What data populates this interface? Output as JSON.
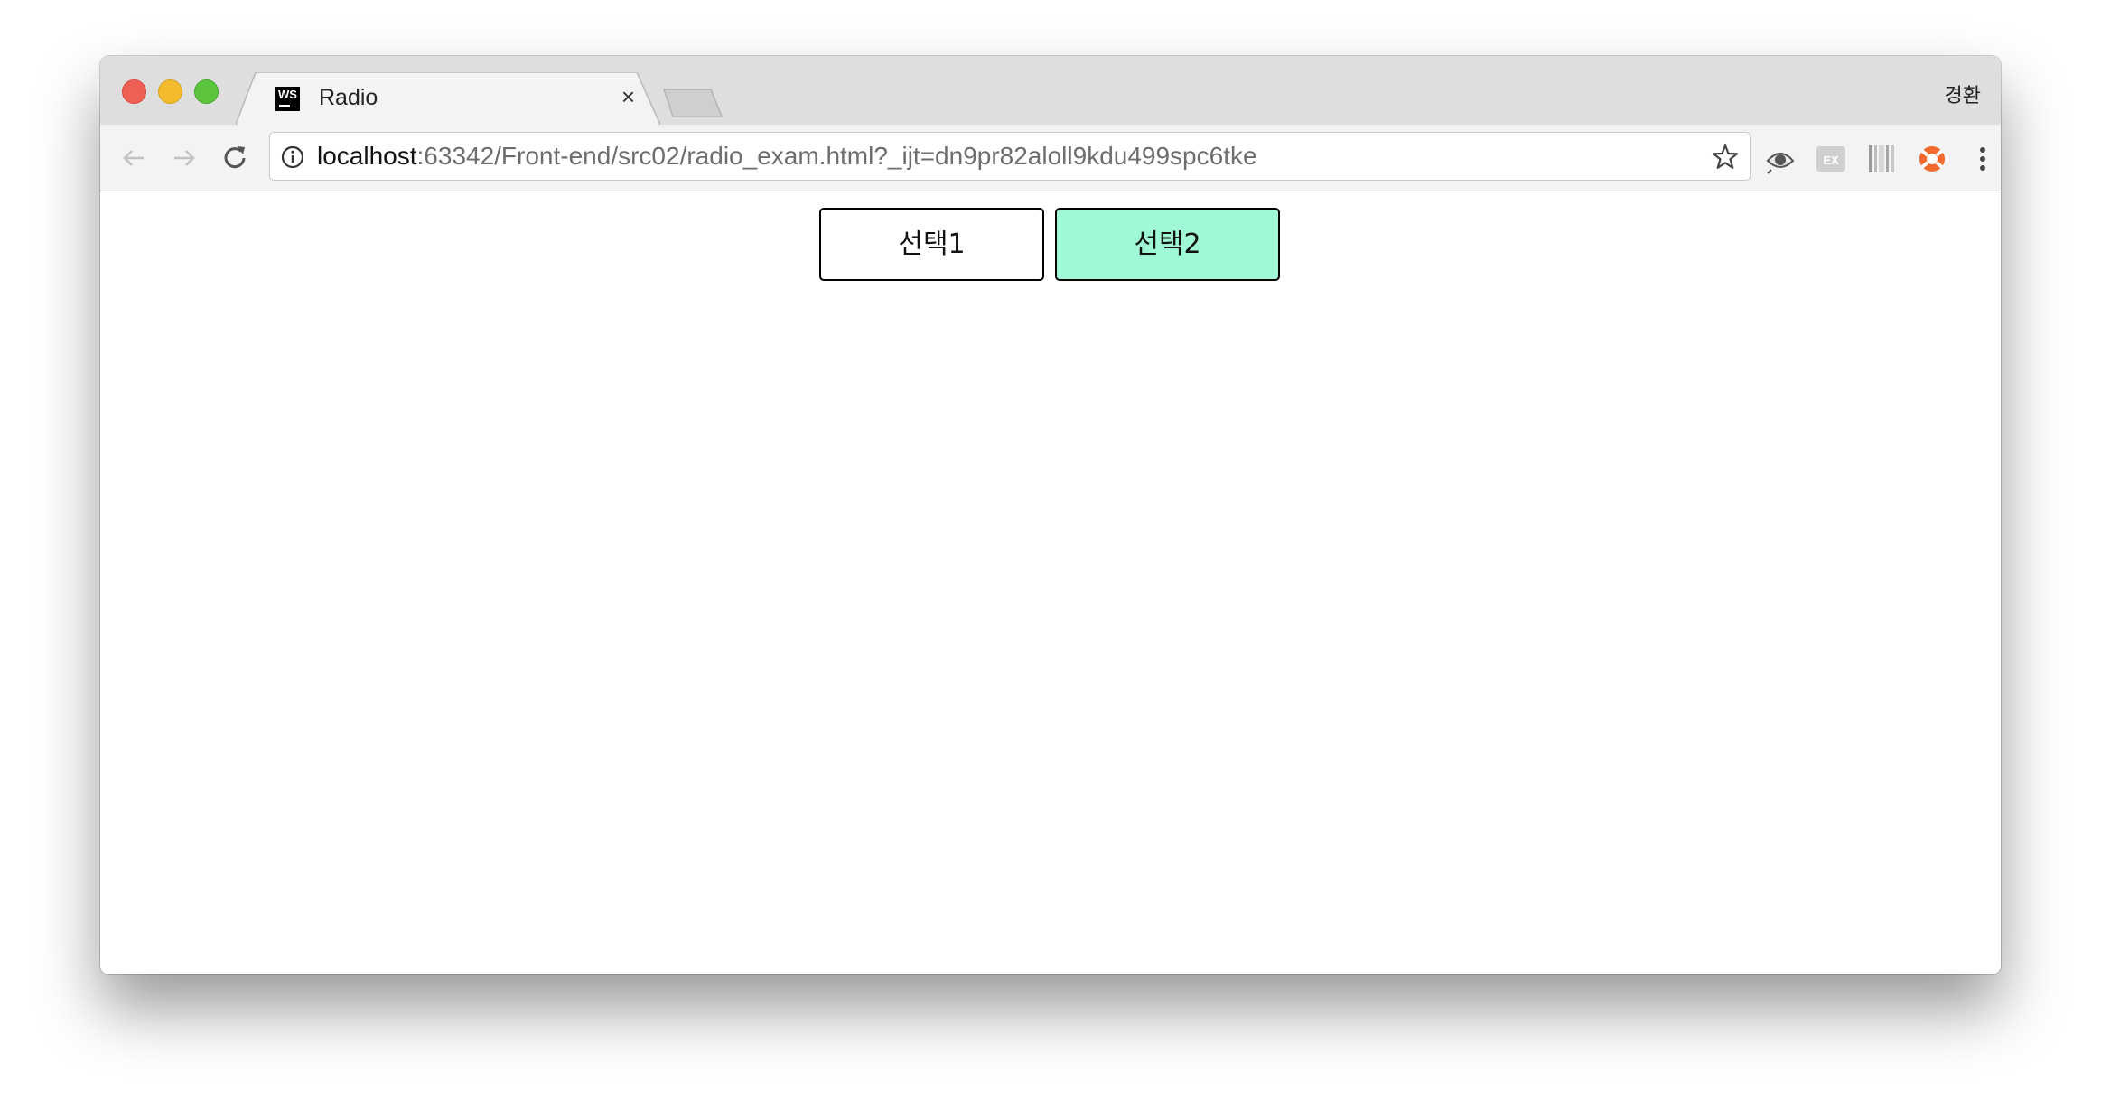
{
  "window": {
    "tab_title": "Radio",
    "favicon_text": "WS",
    "tab_close": "×",
    "profile_name": "경환"
  },
  "toolbar": {
    "url_host": "localhost",
    "url_rest": ":63342/Front-end/src02/radio_exam.html?_ijt=dn9pr82aloll9kdu499spc6tke"
  },
  "content": {
    "options": [
      {
        "label": "선택1",
        "selected": false
      },
      {
        "label": "선택2",
        "selected": true
      }
    ],
    "selected_color": "#9ff9d6"
  },
  "icons": [
    "back-arrow-icon",
    "forward-arrow-icon",
    "reload-icon",
    "info-icon",
    "star-icon",
    "eye-extension-icon",
    "ex-extension-icon",
    "barcode-extension-icon",
    "lifebuoy-extension-icon",
    "menu-dots-icon"
  ]
}
